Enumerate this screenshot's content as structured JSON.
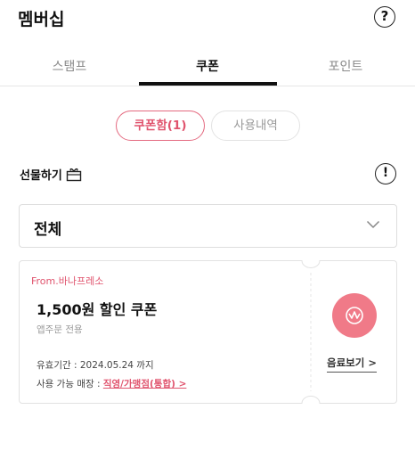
{
  "header": {
    "title": "멤버십",
    "help_icon": "help-circle-icon",
    "help_glyph": "?"
  },
  "tabs": [
    {
      "label": "스탬프",
      "active": false
    },
    {
      "label": "쿠폰",
      "active": true
    },
    {
      "label": "포인트",
      "active": false
    }
  ],
  "segments": {
    "coupon_box": "쿠폰함(1)",
    "history": "사용내역"
  },
  "gift": {
    "label": "선물하기",
    "icon": "gift-box-icon",
    "info_glyph": "!"
  },
  "filter": {
    "value": "전체"
  },
  "coupons": [
    {
      "from": "From.바나프레소",
      "name": "1,500원 할인 쿠폰",
      "sub": "앱주문 전용",
      "valid": "유효기간 : 2024.05.24 까지",
      "store_label": "사용 가능 매장 : ",
      "store_link": "직영/가맹점(통합) >",
      "view_label": "음료보기 >",
      "badge_icon": "brand-logo-icon"
    }
  ],
  "colors": {
    "accent": "#e0536d",
    "badge": "#f07a88",
    "border": "#dedede"
  }
}
